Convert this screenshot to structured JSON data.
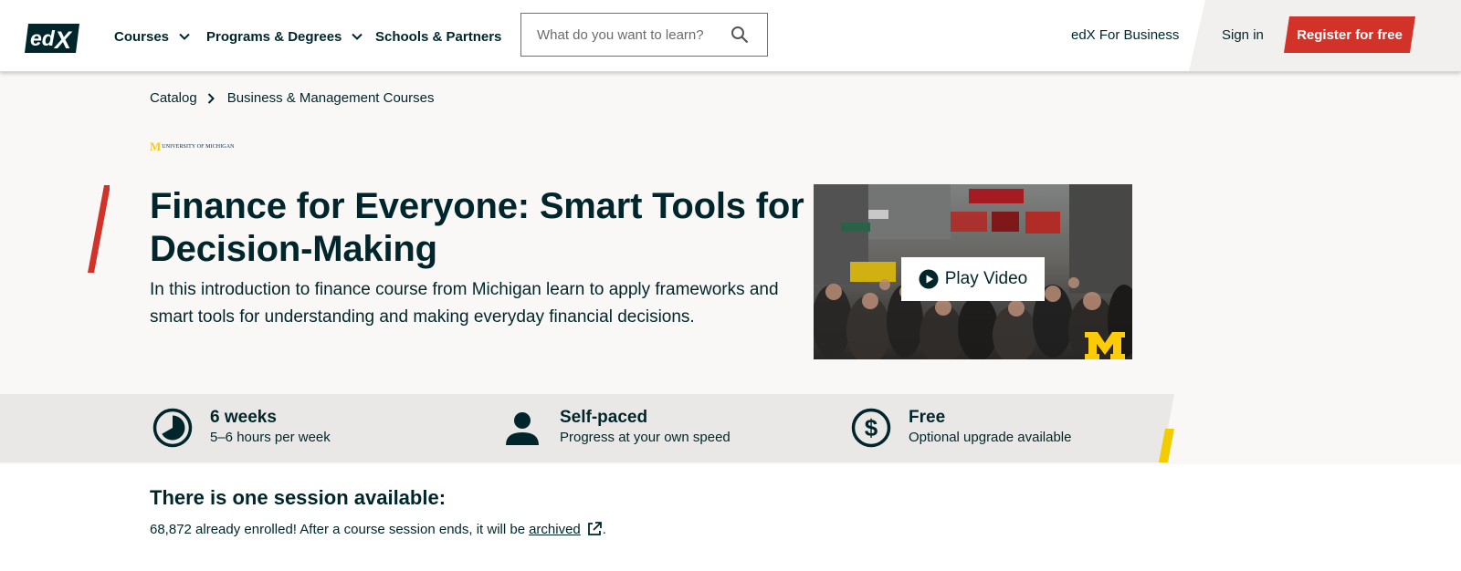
{
  "header": {
    "logo_alt": "edX",
    "nav": [
      {
        "label": "Courses",
        "has_dropdown": true
      },
      {
        "label": "Programs & Degrees",
        "has_dropdown": true
      },
      {
        "label": "Schools & Partners",
        "has_dropdown": false
      }
    ],
    "search": {
      "placeholder": "What do you want to learn?",
      "value": "",
      "icon": "search-icon"
    },
    "business_link": "edX For Business",
    "sign_in": "Sign in",
    "register": "Register for free"
  },
  "breadcrumb": [
    "Catalog",
    "Business & Management Courses"
  ],
  "partner": {
    "mark": "M",
    "name": "UNIVERSITY OF MICHIGAN"
  },
  "course": {
    "title": "Finance for Everyone: Smart Tools for Decision-Making",
    "description": "In this introduction to finance course from Michigan learn to apply frameworks and smart tools for understanding and making everyday financial decisions."
  },
  "video": {
    "play_label": "Play Video"
  },
  "stats": [
    {
      "icon": "clock-icon",
      "title": "6 weeks",
      "subtitle": "5–6 hours per week"
    },
    {
      "icon": "person-icon",
      "title": "Self-paced",
      "subtitle": "Progress at your own speed"
    },
    {
      "icon": "dollar-icon",
      "title": "Free",
      "subtitle": "Optional upgrade available"
    }
  ],
  "session": {
    "title": "There is one session available:",
    "note": "68,872 already enrolled! After a course session ends, it will be",
    "archived_link": "archived",
    "period": "."
  },
  "colors": {
    "brand_dark": "#00262b",
    "accent_red": "#d23228",
    "accent_yellow": "#f0cc00",
    "hero_bg": "#f9f8f7",
    "stats_bg": "#eae8e6"
  }
}
